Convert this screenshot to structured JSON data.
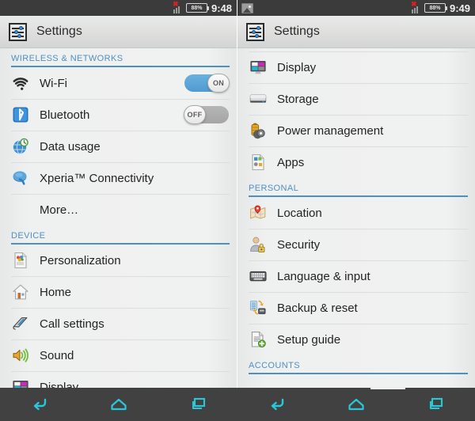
{
  "panels": [
    {
      "id": "left",
      "statusbar": {
        "icons": [],
        "signal_icon": "signal-bars-icon",
        "nosim_icon": "no-sim-icon",
        "battery_text": "88%",
        "time": "9:48"
      },
      "actionbar": {
        "icon": "settings-sliders-icon",
        "title": "Settings"
      },
      "groups": [
        {
          "header": "WIRELESS & NETWORKS",
          "rows": [
            {
              "label": "Wi-Fi",
              "icon": "wifi-icon",
              "toggle": {
                "state": "on",
                "label": "ON"
              }
            },
            {
              "label": "Bluetooth",
              "icon": "bluetooth-icon",
              "toggle": {
                "state": "off",
                "label": "OFF"
              }
            },
            {
              "label": "Data usage",
              "icon": "data-usage-icon"
            },
            {
              "label": "Xperia™ Connectivity",
              "icon": "xperia-connectivity-icon"
            },
            {
              "label": "More…",
              "icon": null
            }
          ]
        },
        {
          "header": "DEVICE",
          "rows": [
            {
              "label": "Personalization",
              "icon": "personalization-icon"
            },
            {
              "label": "Home",
              "icon": "home-icon"
            },
            {
              "label": "Call settings",
              "icon": "call-settings-icon"
            },
            {
              "label": "Sound",
              "icon": "sound-icon"
            },
            {
              "label": "Display",
              "icon": "display-icon",
              "clipped": true
            }
          ]
        }
      ]
    },
    {
      "id": "right",
      "statusbar": {
        "icons": [
          "screenshot-icon"
        ],
        "signal_icon": "signal-bars-icon",
        "nosim_icon": "no-sim-icon",
        "battery_text": "88%",
        "time": "9:49"
      },
      "actionbar": {
        "icon": "settings-sliders-icon",
        "title": "Settings"
      },
      "groups": [
        {
          "header": null,
          "rows": [
            {
              "label": "Display",
              "icon": "display-icon"
            },
            {
              "label": "Storage",
              "icon": "storage-icon"
            },
            {
              "label": "Power management",
              "icon": "power-management-icon"
            },
            {
              "label": "Apps",
              "icon": "apps-icon"
            }
          ]
        },
        {
          "header": "PERSONAL",
          "rows": [
            {
              "label": "Location",
              "icon": "location-icon"
            },
            {
              "label": "Security",
              "icon": "security-icon"
            },
            {
              "label": "Language & input",
              "icon": "language-input-icon"
            },
            {
              "label": "Backup & reset",
              "icon": "backup-reset-icon"
            },
            {
              "label": "Setup guide",
              "icon": "setup-guide-icon"
            }
          ]
        },
        {
          "header": "ACCOUNTS",
          "rows": []
        }
      ]
    }
  ],
  "navbar": {
    "buttons": [
      {
        "name": "back-button",
        "icon": "back-arrow-icon"
      },
      {
        "name": "home-button",
        "icon": "home-outline-icon"
      },
      {
        "name": "recents-button",
        "icon": "recent-apps-icon"
      }
    ],
    "accent_color": "#28c8d8"
  },
  "colors": {
    "section_blue": "#4e8fc4",
    "nav_accent": "#28c8d8",
    "statusbar_bg": "#3b3b3b",
    "navbar_bg": "#414141",
    "list_bg": "#f0f1f1",
    "toggle_on": "#4f9bd1",
    "toggle_off": "#a5a5a5"
  }
}
